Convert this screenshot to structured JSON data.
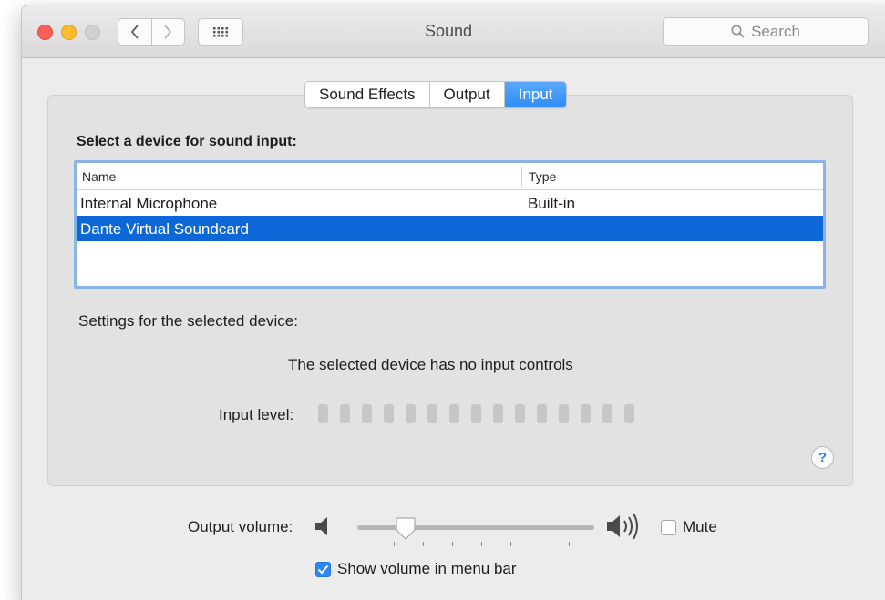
{
  "window": {
    "title": "Sound",
    "search_placeholder": "Search",
    "icons": {
      "back": "chevron-left-icon",
      "forward": "chevron-right-icon",
      "show_all": "grid-icon",
      "search": "search-icon"
    }
  },
  "tabs": [
    {
      "label": "Sound Effects",
      "active": false
    },
    {
      "label": "Output",
      "active": false
    },
    {
      "label": "Input",
      "active": true
    }
  ],
  "input": {
    "heading": "Select a device for sound input:",
    "columns": {
      "name": "Name",
      "type": "Type"
    },
    "devices": [
      {
        "name": "Internal Microphone",
        "type": "Built-in",
        "selected": false
      },
      {
        "name": "Dante Virtual Soundcard",
        "type": "",
        "selected": true
      }
    ],
    "settings_label": "Settings for the selected device:",
    "no_controls_message": "The selected device has no input controls",
    "input_level_label": "Input level:",
    "input_level_segments": 15,
    "help_label": "?"
  },
  "output_volume": {
    "label": "Output volume:",
    "level_fraction": 0.15,
    "mute_label": "Mute",
    "mute_checked": false,
    "icons": {
      "low": "speaker-low-icon",
      "high": "speaker-high-icon"
    }
  },
  "menu_bar": {
    "label": "Show volume in menu bar",
    "checked": true
  },
  "colors": {
    "accent": "#2f86f5",
    "selection": "#0e67d6",
    "close": "#fc5f57",
    "minimize": "#fdbc2e",
    "zoom_inactive": "#d1d1d1"
  }
}
